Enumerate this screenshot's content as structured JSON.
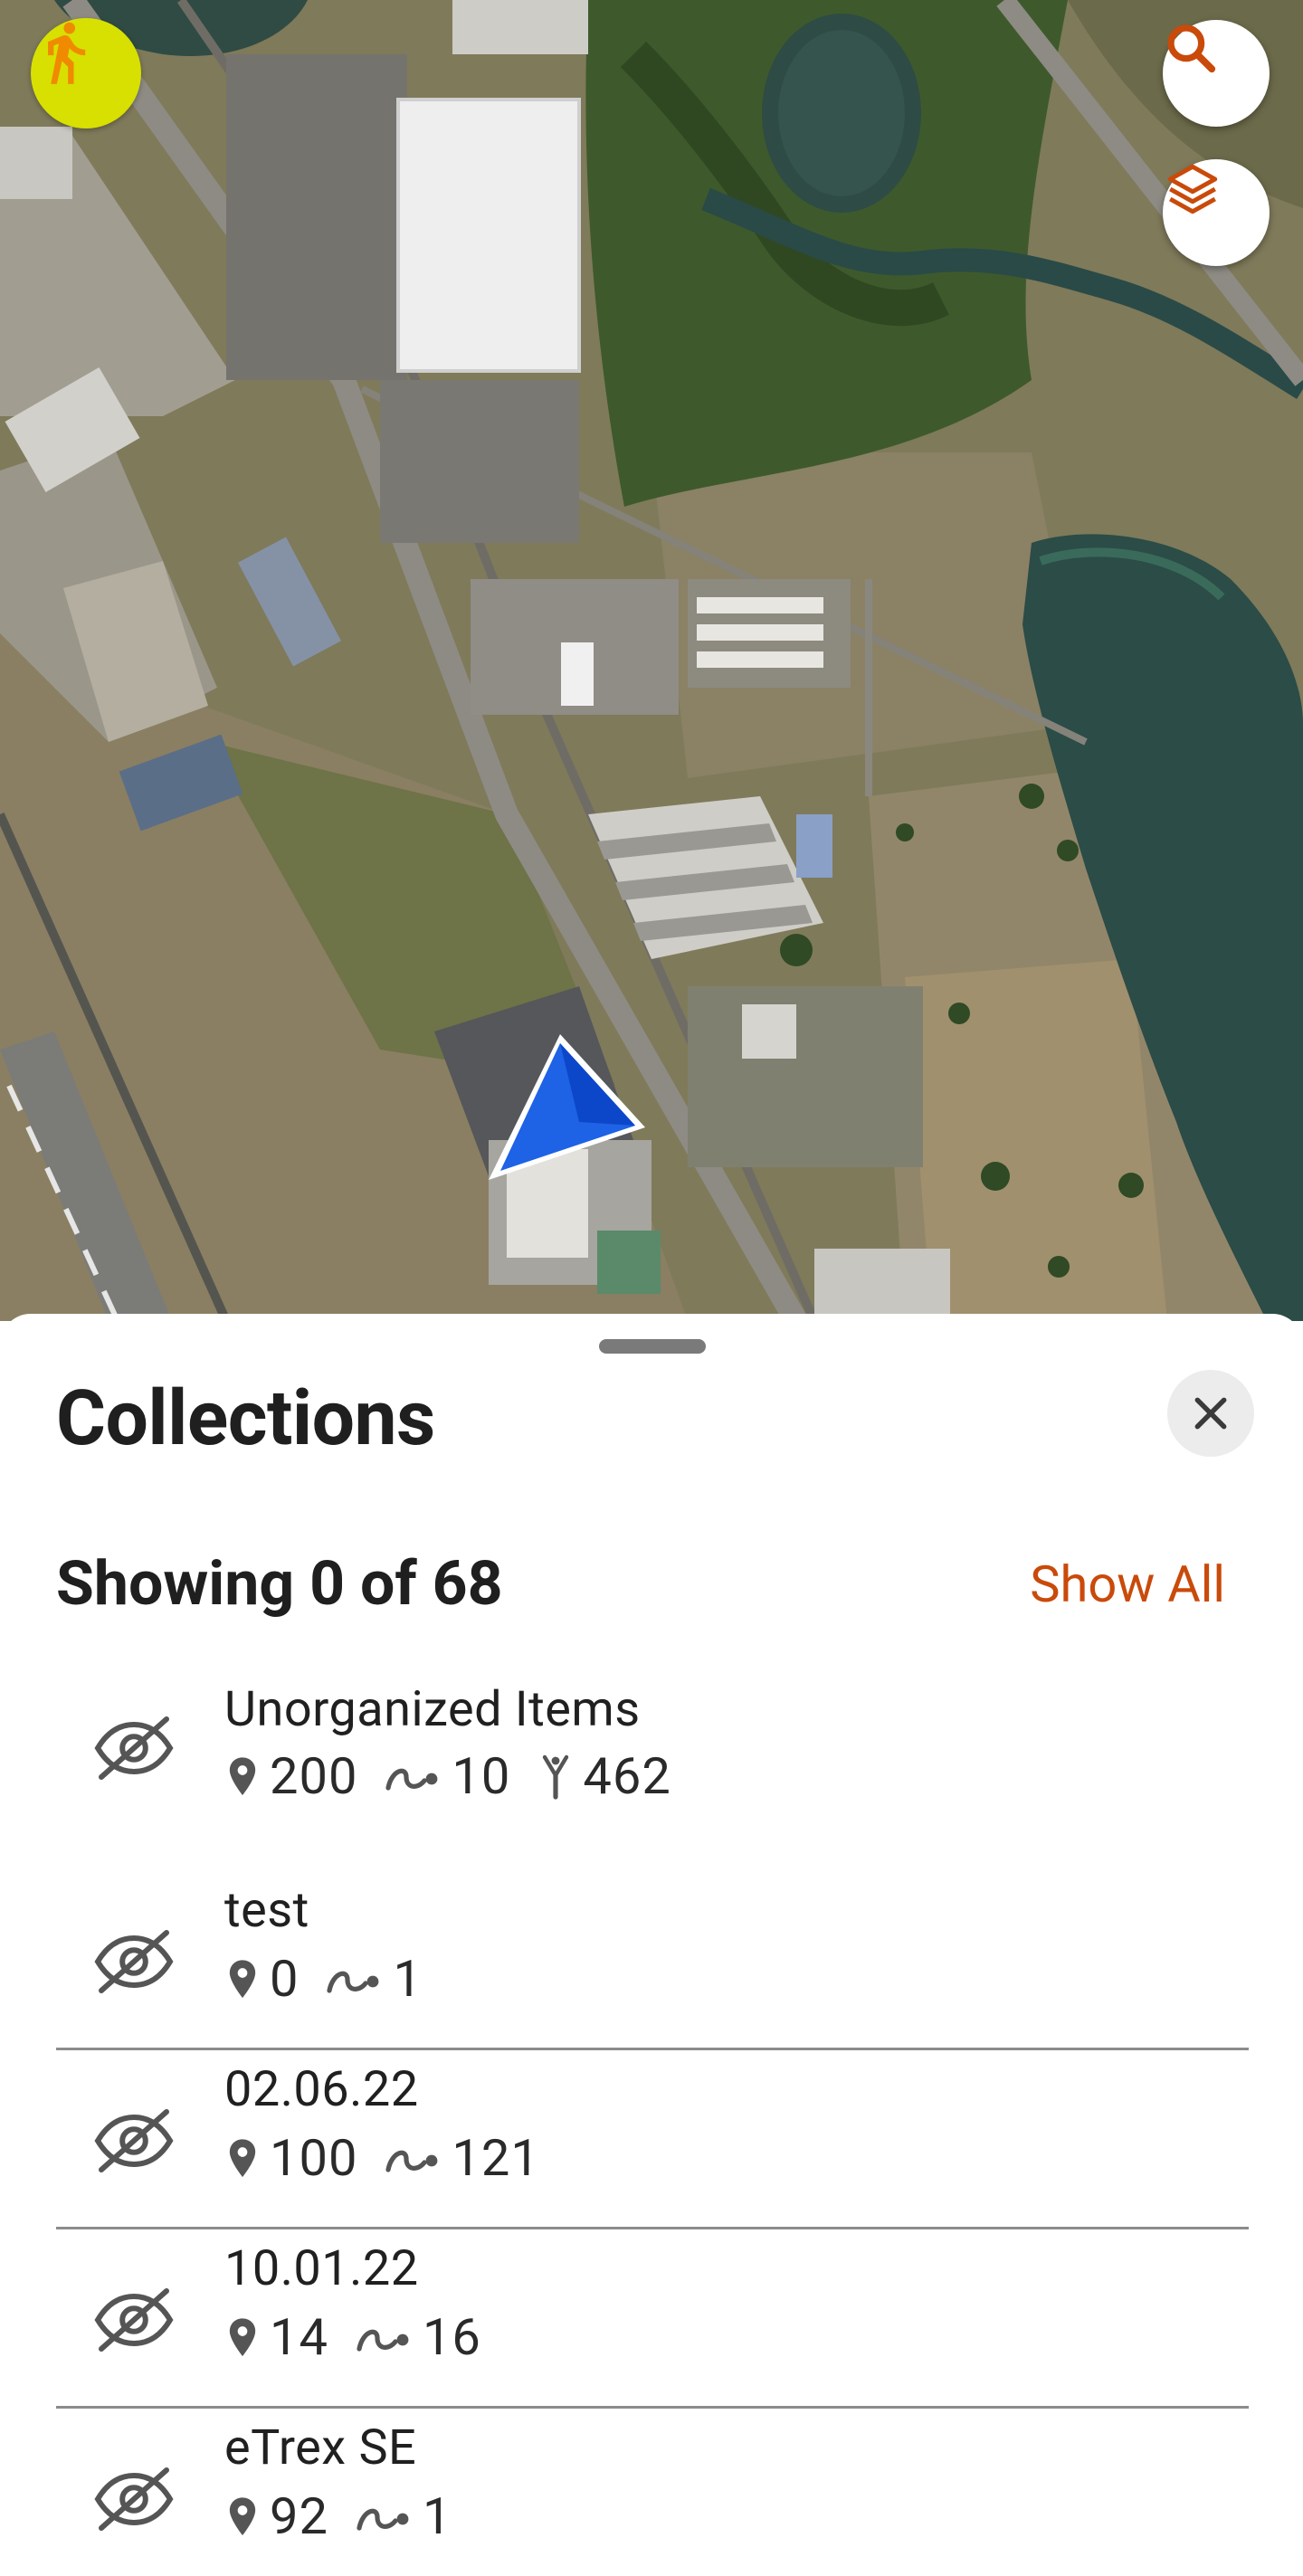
{
  "map": {
    "search_icon": "search-icon",
    "layers_icon": "layers-icon",
    "activity_icon": "running-person-icon",
    "activity_color": "#d7e000",
    "location_arrow_color": "#1565e8",
    "accent_color": "#c94a0a"
  },
  "sheet": {
    "title": "Collections",
    "showing": "Showing 0 of 68",
    "show_all": "Show All",
    "close_icon": "close-icon"
  },
  "collections": [
    {
      "name": "Unorganized Items",
      "waypoints": "200",
      "tracks": "10",
      "routes": "462",
      "visible": false
    },
    {
      "name": "test",
      "waypoints": "0",
      "tracks": "1",
      "visible": false
    },
    {
      "name": "02.06.22",
      "waypoints": "100",
      "tracks": "121",
      "visible": false
    },
    {
      "name": "10.01.22",
      "waypoints": "14",
      "tracks": "16",
      "visible": false
    },
    {
      "name": "eTrex SE",
      "waypoints": "92",
      "tracks": "1",
      "visible": false
    }
  ]
}
